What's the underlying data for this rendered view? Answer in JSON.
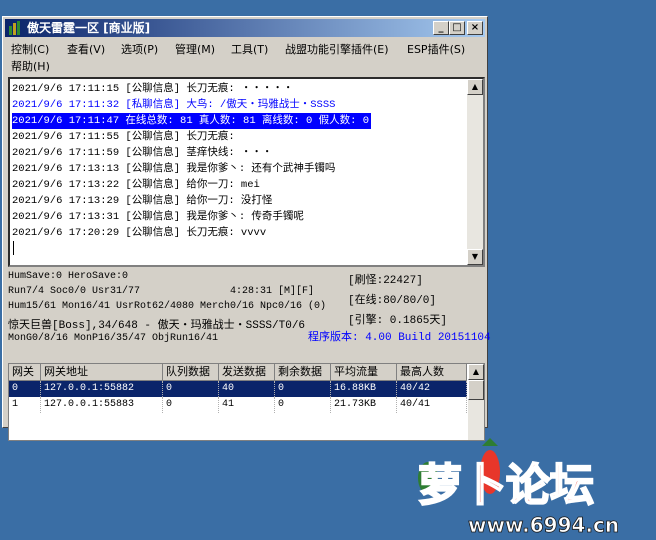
{
  "window": {
    "title": "傲天雷霆一区 [商业版]",
    "buttons": [
      "_",
      "□",
      "×"
    ]
  },
  "menu": {
    "items": [
      "控制(C)",
      "查看(V)",
      "选项(P)",
      "管理(M)",
      "工具(T)",
      "战盟功能引擎插件(E)",
      "ESP插件(S)",
      "帮助(H)"
    ]
  },
  "log": {
    "lines": [
      {
        "text": "2021/9/6 17:11:15 [公聊信息] 长刀无痕: ・・・・・",
        "color": "#000000"
      },
      {
        "text": "2021/9/6 17:11:32 [私聊信息] 大鸟: /傲天・玛雅战士・SSSS",
        "color": "#0000ff"
      },
      {
        "text": "2021/9/6 17:11:47 在线总数: 81 真人数: 81 离线数: 0 假人数: 0",
        "color": "#ffffff"
      },
      {
        "text": "2021/9/6 17:11:55 [公聊信息] 长刀无痕:",
        "color": "#000000"
      },
      {
        "text": "2021/9/6 17:11:59 [公聊信息] 茎痒快线: ・・・",
        "color": "#000000"
      },
      {
        "text": "2021/9/6 17:13:13 [公聊信息] 我是你爹丶: 还有个武神手镯吗",
        "color": "#000000"
      },
      {
        "text": "2021/9/6 17:13:22 [公聊信息] 给你一刀: mei",
        "color": "#000000"
      },
      {
        "text": "2021/9/6 17:13:29 [公聊信息] 给你一刀: 没打怪",
        "color": "#000000"
      },
      {
        "text": "2021/9/6 17:13:31 [公聊信息] 我是你爹丶: 传奇手镯呢",
        "color": "#000000"
      },
      {
        "text": "2021/9/6 17:20:29 [公聊信息] 长刀无痕: vvvv",
        "color": "#000000"
      }
    ],
    "highlight_bg": "#0000ff"
  },
  "status": {
    "line1": "HumSave:0 HeroSave:0",
    "line2": "Run7/4 Soc0/0 Usr31/77",
    "time": "4:28:31 [M][F]",
    "line3": "Hum15/61 Mon16/41 UsrRot62/4080 Merch0/16 Npc0/16 (0)",
    "line4": "惊天巨兽[Boss],34/648 - 傲天・玛雅战士・SSSS/T0/6",
    "line5": "MonG0/8/16 MonP16/35/47 ObjRun16/41",
    "refresh": "[刷怪:22427]",
    "online": "[在线:80/80/0]",
    "engine": "[引擎: 0.1865天]",
    "version": "程序版本: 4.00 Build 20151104",
    "version_color": "#0000ff"
  },
  "grid": {
    "headers": [
      "网关",
      "网关地址",
      "队列数据",
      "发送数据",
      "剩余数据",
      "平均流量",
      "最高人数"
    ],
    "rows": [
      [
        "0",
        "127.0.0.1:55882",
        "0",
        "40",
        "0",
        "16.88KB",
        "40/42"
      ],
      [
        "1",
        "127.0.0.1:55883",
        "0",
        "41",
        "0",
        "21.73KB",
        "40/41"
      ]
    ],
    "selected_bg": "#0a246a"
  },
  "logo": {
    "text": "萝卜论坛",
    "url": "www.6994.cn",
    "colors": [
      "#e8362a",
      "#f5a623",
      "#2e7d32"
    ]
  }
}
